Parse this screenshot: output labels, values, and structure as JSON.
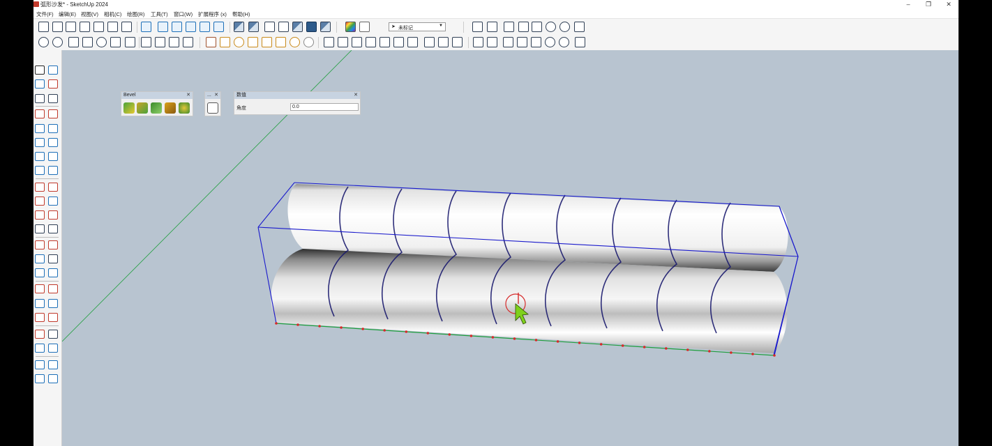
{
  "window": {
    "title": "弧形沙发* - SketchUp 2024"
  },
  "menu": [
    "文件(F)",
    "编辑(E)",
    "视图(V)",
    "相机(C)",
    "绘图(R)",
    "工具(T)",
    "窗口(W)",
    "扩展程序 (x)",
    "帮助(H)"
  ],
  "toolbar": {
    "tag_select_value": "未标记"
  },
  "panels": {
    "bevel": {
      "title": "Bevel"
    },
    "small": {
      "title": "..."
    },
    "measure": {
      "title": "数值",
      "label": "角度",
      "value": "0.0"
    }
  },
  "colors": {
    "viewport_bg": "#b8c4d0",
    "selection_box": "#1a1acc",
    "green_axis": "#1e9e3c",
    "red_points": "#d62a2a",
    "cursor_green": "#7fd11c"
  }
}
